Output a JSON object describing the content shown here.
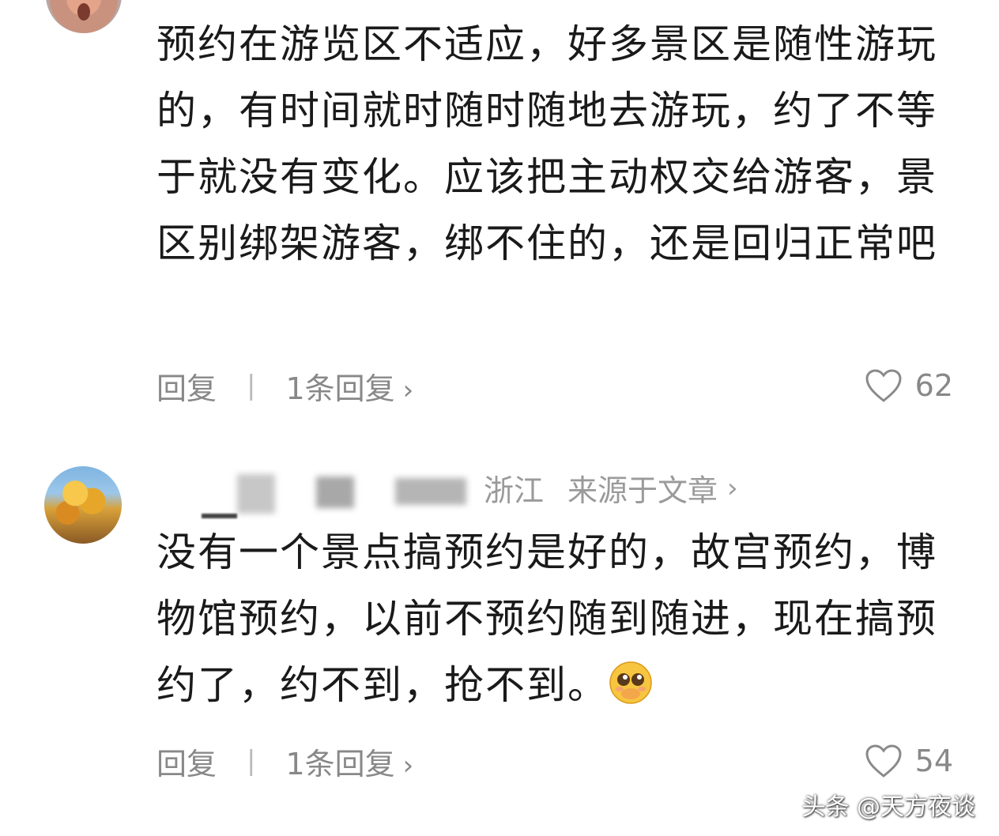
{
  "comments": [
    {
      "text": "预约在游览区不适应，好多景区是随性游玩的，有时间就时随时随地去游玩，约了不等于就没有变化。应该把主动权交给游客，景区别绑架游客，绑不住的，还是回归正常吧",
      "reply_label": "回复",
      "replies_label": "1条回复",
      "likes": "62"
    },
    {
      "location": "浙江",
      "source": "来源于文章",
      "text": "没有一个景点搞预约是好的，故宫预约，博物馆预约，以前不预约随到随进，现在搞预约了，约不到，抢不到。",
      "reply_label": "回复",
      "replies_label": "1条回复",
      "likes": "54"
    }
  ],
  "watermark": "头条 @天方夜谈",
  "icons": {
    "heart": "heart-outline-icon",
    "chevron": "chevron-right-icon",
    "emoji": "pleading-face-emoji"
  }
}
